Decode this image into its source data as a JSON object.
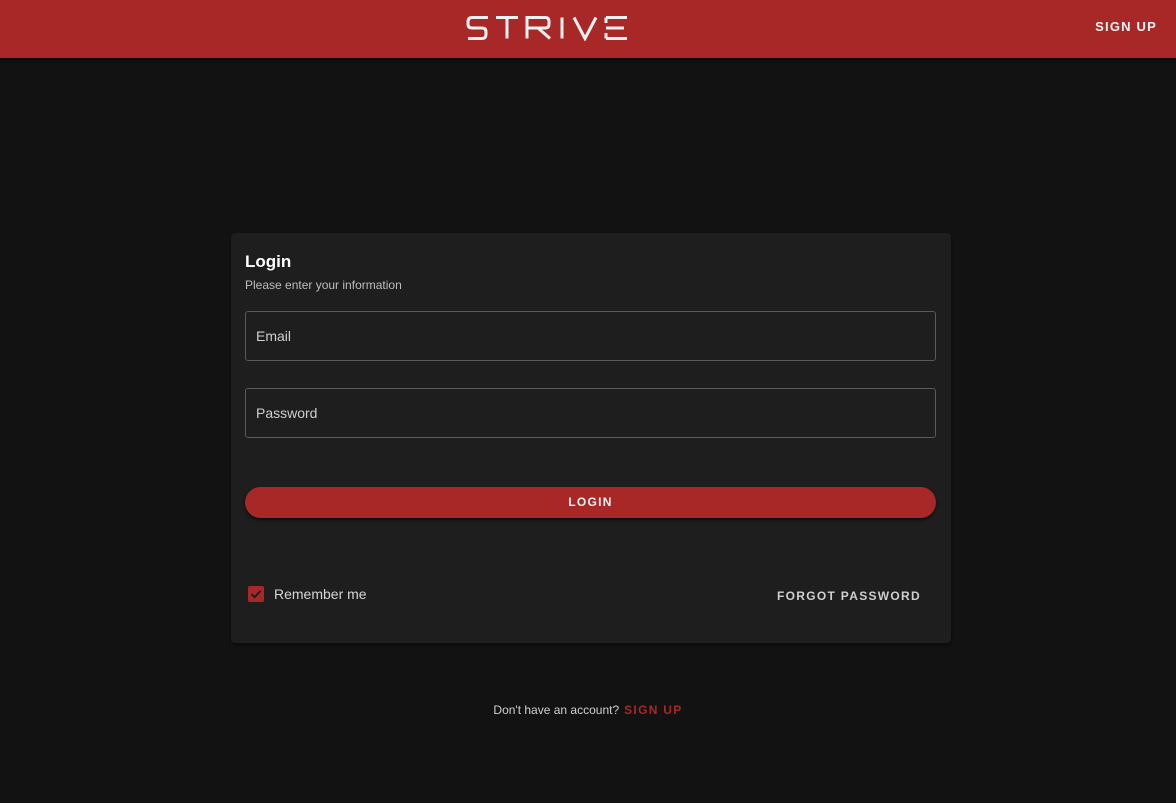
{
  "header": {
    "logo_text": "STRIVE",
    "signup_label": "SIGN UP"
  },
  "login_card": {
    "title": "Login",
    "subtitle": "Please enter your information",
    "email_placeholder": "Email",
    "password_placeholder": "Password",
    "login_label": "LOGIN",
    "remember_label": "Remember me",
    "remember_checked": true,
    "forgot_label": "FORGOT PASSWORD"
  },
  "footer": {
    "prompt": "Don't have an account?",
    "signup_label": "SIGN UP"
  },
  "colors": {
    "brand": "#a82828",
    "background": "#121212",
    "card": "#1e1e1e"
  }
}
